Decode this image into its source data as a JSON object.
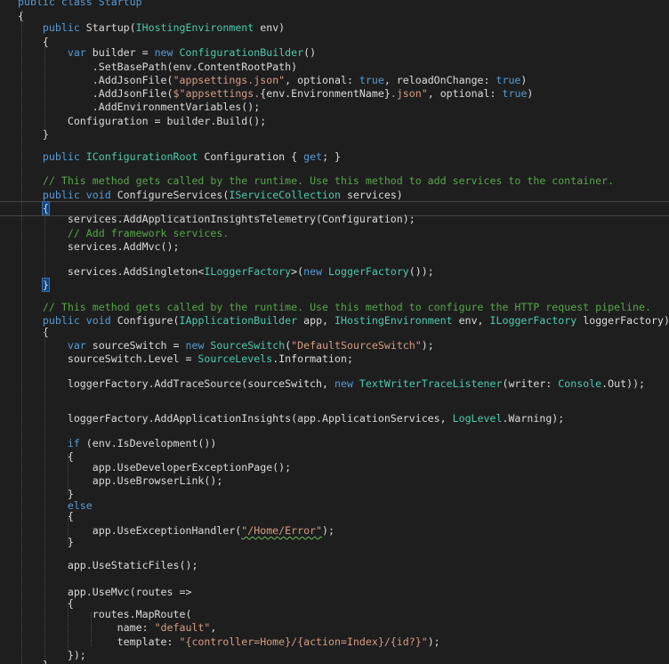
{
  "editor": {
    "language": "C#",
    "theme_colors": {
      "background": "#1e1e1e",
      "keyword": "#569cd6",
      "type": "#4ec9b0",
      "string": "#d69d85",
      "comment": "#57a64a",
      "text": "#dcdcdc"
    },
    "lines": [
      [
        [
          "public class Startup",
          "kw"
        ]
      ],
      [
        [
          "{",
          "t"
        ]
      ],
      [
        [
          "    ",
          "t"
        ],
        [
          "public",
          "kw"
        ],
        [
          " Startup(",
          "t"
        ],
        [
          "IHostingEnvironment",
          "ty"
        ],
        [
          " env)",
          "t"
        ]
      ],
      [
        [
          "    {",
          "t"
        ]
      ],
      [
        [
          "        ",
          "t"
        ],
        [
          "var",
          "kw"
        ],
        [
          " builder = ",
          "t"
        ],
        [
          "new",
          "kw"
        ],
        [
          " ",
          "t"
        ],
        [
          "ConfigurationBuilder",
          "ty"
        ],
        [
          "()",
          "t"
        ]
      ],
      [
        [
          "            .SetBasePath(env.ContentRootPath)",
          "t"
        ]
      ],
      [
        [
          "            .AddJsonFile(",
          "t"
        ],
        [
          "\"appsettings.json\"",
          "st"
        ],
        [
          ", optional: ",
          "t"
        ],
        [
          "true",
          "kw"
        ],
        [
          ", reloadOnChange: ",
          "t"
        ],
        [
          "true",
          "kw"
        ],
        [
          ")",
          "t"
        ]
      ],
      [
        [
          "            .AddJsonFile(",
          "t"
        ],
        [
          "$\"appsettings.",
          "st"
        ],
        [
          "{env.EnvironmentName}",
          "t"
        ],
        [
          ".json\"",
          "st"
        ],
        [
          ", optional: ",
          "t"
        ],
        [
          "true",
          "kw"
        ],
        [
          ")",
          "t"
        ]
      ],
      [
        [
          "            .AddEnvironmentVariables();",
          "t"
        ]
      ],
      [
        [
          "        Configuration = builder.Build();",
          "t"
        ]
      ],
      [
        [
          "    }",
          "t"
        ]
      ],
      [],
      [
        [
          "    ",
          "t"
        ],
        [
          "public",
          "kw"
        ],
        [
          " ",
          "t"
        ],
        [
          "IConfigurationRoot",
          "ty"
        ],
        [
          " Configuration { ",
          "t"
        ],
        [
          "get",
          "kw"
        ],
        [
          "; }",
          "t"
        ]
      ],
      [],
      [
        [
          "    ",
          "t"
        ],
        [
          "// This method gets called by the runtime. Use this method to add services to the container.",
          "cm"
        ]
      ],
      [
        [
          "    ",
          "t"
        ],
        [
          "public",
          "kw"
        ],
        [
          " ",
          "t"
        ],
        [
          "void",
          "kw"
        ],
        [
          " ConfigureServices(",
          "t"
        ],
        [
          "IServiceCollection",
          "ty"
        ],
        [
          " services)",
          "t"
        ]
      ],
      [
        [
          "    ",
          "t"
        ],
        [
          "{",
          "br"
        ]
      ],
      [
        [
          "        services.AddApplicationInsightsTelemetry(Configuration);",
          "t"
        ]
      ],
      [
        [
          "        ",
          "t"
        ],
        [
          "// Add framework services.",
          "cm"
        ]
      ],
      [
        [
          "        services.AddMvc();",
          "t"
        ]
      ],
      [],
      [
        [
          "        services.AddSingleton<",
          "t"
        ],
        [
          "ILoggerFactory",
          "ty"
        ],
        [
          ">(",
          "t"
        ],
        [
          "new",
          "kw"
        ],
        [
          " ",
          "t"
        ],
        [
          "LoggerFactory",
          "ty"
        ],
        [
          "());",
          "t"
        ]
      ],
      [
        [
          "    ",
          "t"
        ],
        [
          "}",
          "br"
        ]
      ],
      [],
      [
        [
          "    ",
          "t"
        ],
        [
          "// This method gets called by the runtime. Use this method to configure the HTTP request pipeline.",
          "cm"
        ]
      ],
      [
        [
          "    ",
          "t"
        ],
        [
          "public",
          "kw"
        ],
        [
          " ",
          "t"
        ],
        [
          "void",
          "kw"
        ],
        [
          " Configure(",
          "t"
        ],
        [
          "IApplicationBuilder",
          "ty"
        ],
        [
          " app, ",
          "t"
        ],
        [
          "IHostingEnvironment",
          "ty"
        ],
        [
          " env, ",
          "t"
        ],
        [
          "ILoggerFactory",
          "ty"
        ],
        [
          " loggerFactory)",
          "t"
        ]
      ],
      [
        [
          "    {",
          "t"
        ]
      ],
      [
        [
          "        ",
          "t"
        ],
        [
          "var",
          "kw"
        ],
        [
          " sourceSwitch = ",
          "t"
        ],
        [
          "new",
          "kw"
        ],
        [
          " ",
          "t"
        ],
        [
          "SourceSwitch",
          "ty"
        ],
        [
          "(",
          "t"
        ],
        [
          "\"DefaultSourceSwitch\"",
          "st"
        ],
        [
          ");",
          "t"
        ]
      ],
      [
        [
          "        sourceSwitch.Level = ",
          "t"
        ],
        [
          "SourceLevels",
          "ty"
        ],
        [
          ".Information;",
          "t"
        ]
      ],
      [],
      [
        [
          "        loggerFactory.AddTraceSource(sourceSwitch, ",
          "t"
        ],
        [
          "new",
          "kw"
        ],
        [
          " ",
          "t"
        ],
        [
          "TextWriterTraceListener",
          "ty"
        ],
        [
          "(writer: ",
          "t"
        ],
        [
          "Console",
          "ty"
        ],
        [
          ".Out));",
          "t"
        ]
      ],
      [],
      [],
      [
        [
          "        loggerFactory.AddApplicationInsights(app.ApplicationServices, ",
          "t"
        ],
        [
          "LogLevel",
          "ty"
        ],
        [
          ".Warning);",
          "t"
        ]
      ],
      [],
      [
        [
          "        ",
          "t"
        ],
        [
          "if",
          "kw"
        ],
        [
          " (env.IsDevelopment())",
          "t"
        ]
      ],
      [
        [
          "        {",
          "t"
        ]
      ],
      [
        [
          "            app.UseDeveloperExceptionPage();",
          "t"
        ]
      ],
      [
        [
          "            app.UseBrowserLink();",
          "t"
        ]
      ],
      [
        [
          "        }",
          "t"
        ]
      ],
      [
        [
          "        ",
          "t"
        ],
        [
          "else",
          "kw"
        ]
      ],
      [
        [
          "        {",
          "t"
        ]
      ],
      [
        [
          "            app.UseExceptionHandler(",
          "t"
        ],
        [
          "\"/Home/Error\"",
          "sq"
        ],
        [
          ");",
          "t"
        ]
      ],
      [
        [
          "        }",
          "t"
        ]
      ],
      [],
      [
        [
          "        app.UseStaticFiles();",
          "t"
        ]
      ],
      [],
      [
        [
          "        app.UseMvc(routes =>",
          "t"
        ]
      ],
      [
        [
          "        {",
          "t"
        ]
      ],
      [
        [
          "            routes.MapRoute(",
          "t"
        ]
      ],
      [
        [
          "                name: ",
          "t"
        ],
        [
          "\"default\"",
          "st"
        ],
        [
          ",",
          "t"
        ]
      ],
      [
        [
          "                template: ",
          "t"
        ],
        [
          "\"{controller=Home}/{action=Index}/{id?}\"",
          "st"
        ],
        [
          ");",
          "t"
        ]
      ],
      [
        [
          "        });",
          "t"
        ]
      ],
      [
        [
          "    }",
          "t"
        ]
      ]
    ]
  }
}
